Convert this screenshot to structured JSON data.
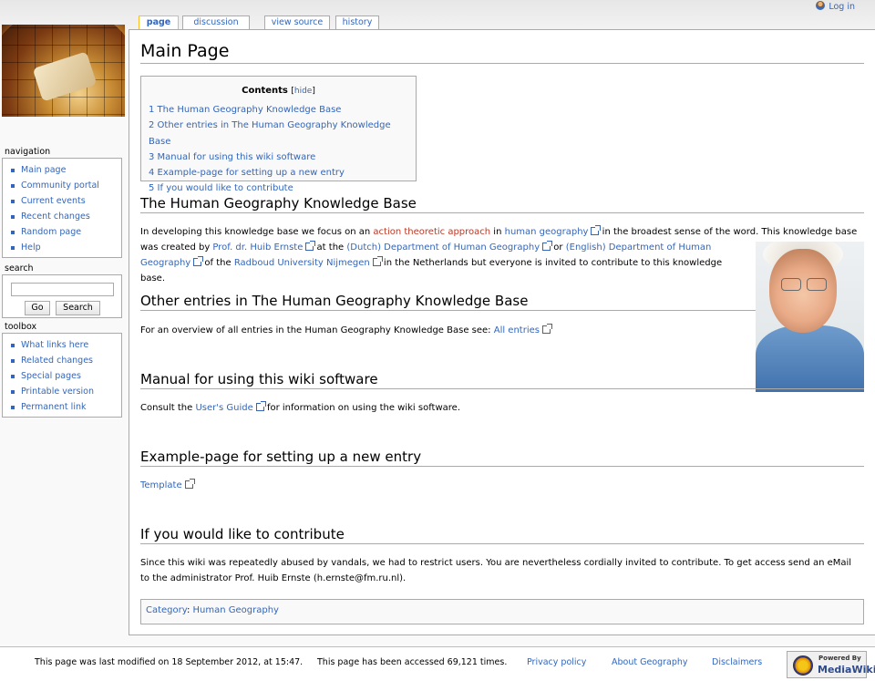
{
  "personal": {
    "login": "Log in"
  },
  "tabs": {
    "page": "page",
    "discussion": "discussion",
    "view_source": "view source",
    "history": "history"
  },
  "sidebar": {
    "navigation_title": "navigation",
    "navigation": [
      "Main page",
      "Community portal",
      "Current events",
      "Recent changes",
      "Random page",
      "Help"
    ],
    "search_title": "search",
    "search_input_value": "",
    "go_label": "Go",
    "search_label": "Search",
    "toolbox_title": "toolbox",
    "toolbox": [
      "What links here",
      "Related changes",
      "Special pages",
      "Printable version",
      "Permanent link"
    ]
  },
  "page": {
    "title": "Main Page",
    "toc": {
      "title": "Contents",
      "hide": "hide",
      "items": [
        "1 The Human Geography Knowledge Base",
        "2 Other entries in The Human Geography Knowledge Base",
        "3 Manual for using this wiki software",
        "4 Example-page for setting up a new entry",
        "5 If you would like to contribute"
      ]
    },
    "sections": {
      "s1": {
        "heading": "The Human Geography Knowledge Base",
        "t1": "In developing this knowledge base we focus on an ",
        "l1": "action theoretic approach",
        "t2": " in ",
        "l2": "human geography",
        "t3": " in the broadest sense of the word. This knowledge base",
        "t4": "was created by ",
        "l3": "Prof. dr. Huib Ernste",
        "t5": " at the ",
        "l4": "(Dutch) Department of Human Geography",
        "t6": " or ",
        "l5": "(English) Department of Human",
        "l5b": "Geography",
        "t7": " of the ",
        "l6": "Radboud University Nijmegen",
        "t8": " in the Netherlands but everyone is invited to contribute to this knowledge",
        "t9": "base."
      },
      "s2": {
        "heading": "Other entries in The Human Geography Knowledge Base",
        "t1": "For an overview of all entries in the Human Geography Knowledge Base see: ",
        "l1": "All entries"
      },
      "s3": {
        "heading": "Manual for using this wiki software",
        "t1": "Consult the ",
        "l1": "User's Guide",
        "t2": " for information on using the wiki software."
      },
      "s4": {
        "heading": "Example-page for setting up a new entry",
        "l1": "Template"
      },
      "s5": {
        "heading": "If you would like to contribute",
        "t1": "Since this wiki was repeatedly abused by vandals, we had to restrict users. You are nevertheless cordially invited to contribute. To get access send an eMail",
        "t2": "to the administrator Prof. Huib Ernste (h.ernste@fm.ru.nl)."
      }
    },
    "category_label": "Category",
    "category": "Human Geography"
  },
  "footer": {
    "lastmod": "This page was last modified on 18 September 2012, at 15:47.",
    "views": "This page has been accessed 69,121 times.",
    "privacy": "Privacy policy",
    "about": "About Geography",
    "disclaimers": "Disclaimers",
    "powered_by": "Powered By",
    "mediawiki": "MediaWiki"
  }
}
